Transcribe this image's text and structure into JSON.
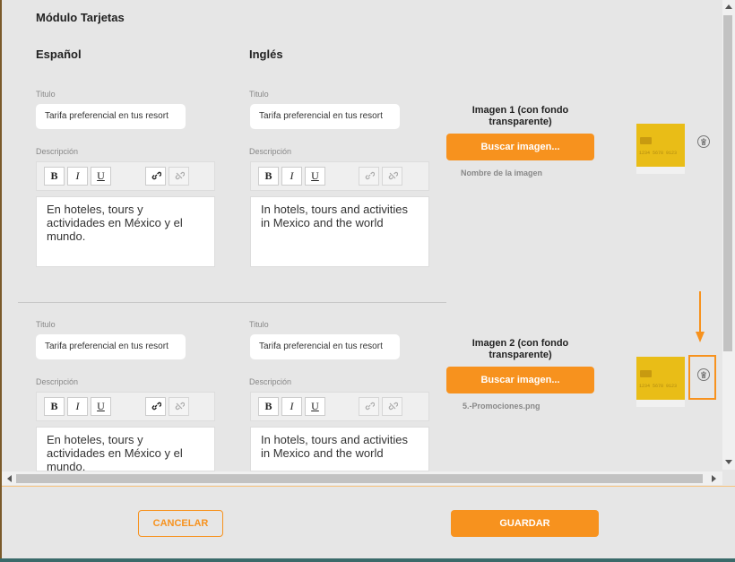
{
  "modal": {
    "title": "Módulo Tarjetas"
  },
  "columns": {
    "spanish": "Español",
    "english": "Inglés"
  },
  "labels": {
    "title": "Titulo",
    "description": "Descripción"
  },
  "cards": [
    {
      "es": {
        "title_value": "Tarifa preferencial en tus resort",
        "description": "En hoteles, tours y actividades en México y el mundo."
      },
      "en": {
        "title_value": "Tarifa preferencial en tus resort",
        "description": "In hotels, tours and activities in Mexico and the world"
      },
      "image_title": "Imagen 1 (con fondo transparente)",
      "search_button": "Buscar imagen...",
      "image_name": "Nombre de la imagen",
      "card_number": "1234 5678 9123"
    },
    {
      "es": {
        "title_value": "Tarifa preferencial en tus resort",
        "description": "En hoteles, tours y actividades en México y el mundo."
      },
      "en": {
        "title_value": "Tarifa preferencial en tus resort",
        "description": "In hotels, tours and activities in Mexico and the world"
      },
      "image_title": "Imagen 2 (con fondo transparente)",
      "search_button": "Buscar imagen...",
      "image_name": "5.-Promociones.png",
      "card_number": "1234 5678 9123"
    }
  ],
  "toolbar": {
    "bold": "B",
    "italic": "I",
    "underline": "U"
  },
  "footer": {
    "cancel": "CANCELAR",
    "save": "GUARDAR"
  },
  "icons": {
    "link": "link-icon",
    "unlink": "unlink-icon",
    "trash": "trash-icon",
    "arrow": "down-arrow-icon"
  },
  "colors": {
    "accent": "#f7921e",
    "background": "#e6e6e6",
    "card": "#e9bd17"
  }
}
